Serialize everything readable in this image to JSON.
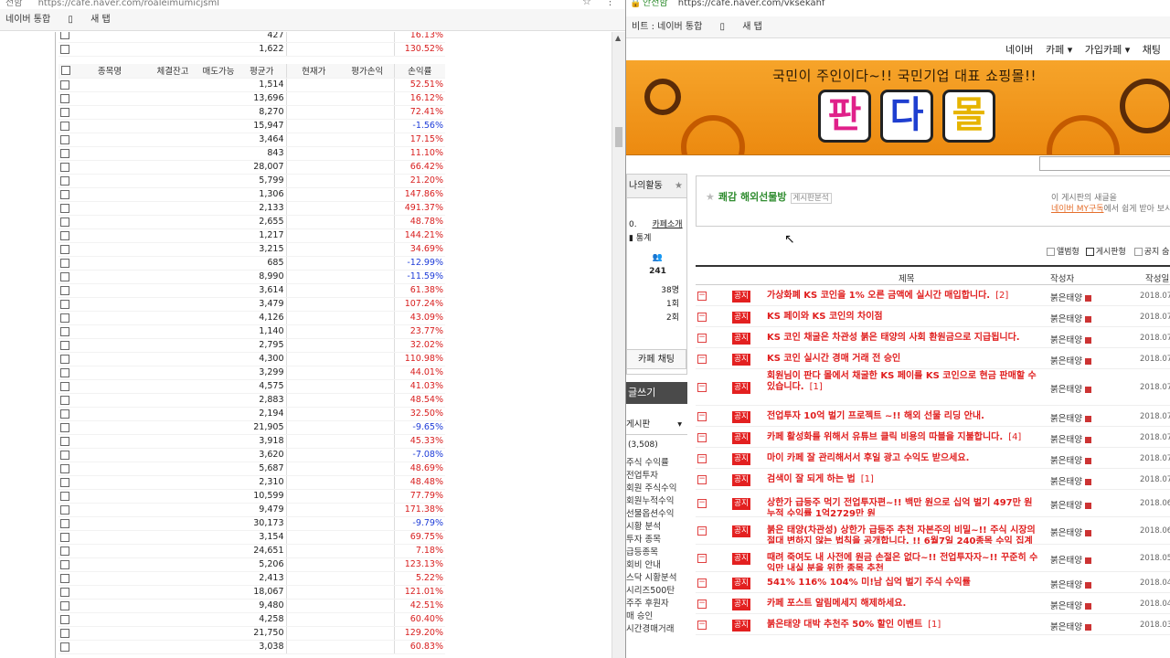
{
  "left_window": {
    "address": "https://cafe.naver.com/roaleimumicjsml",
    "lock_text": "전함",
    "bookmarks": [
      "네이버 통합",
      "새 탭"
    ],
    "top_rows": [
      {
        "avg": "427",
        "ret": "16.13%",
        "sign": "pos"
      },
      {
        "avg": "1,622",
        "ret": "130.52%",
        "sign": "pos"
      }
    ],
    "headers": {
      "name": "종목명",
      "balance": "체결잔고",
      "sellable": "매도가능",
      "avg": "평균가",
      "current": "현재가",
      "eval": "평가손익",
      "ret": "손익률"
    },
    "rows": [
      {
        "avg": "1,514",
        "ret": "52.51%",
        "sign": "pos"
      },
      {
        "avg": "13,696",
        "ret": "16.12%",
        "sign": "pos"
      },
      {
        "avg": "8,270",
        "ret": "72.41%",
        "sign": "pos"
      },
      {
        "avg": "15,947",
        "ret": "-1.56%",
        "sign": "neg"
      },
      {
        "avg": "3,464",
        "ret": "17.15%",
        "sign": "pos"
      },
      {
        "avg": "843",
        "ret": "11.10%",
        "sign": "pos"
      },
      {
        "avg": "28,007",
        "ret": "66.42%",
        "sign": "pos"
      },
      {
        "avg": "5,799",
        "ret": "21.20%",
        "sign": "pos"
      },
      {
        "avg": "1,306",
        "ret": "147.86%",
        "sign": "pos"
      },
      {
        "avg": "2,133",
        "ret": "491.37%",
        "sign": "pos"
      },
      {
        "avg": "2,655",
        "ret": "48.78%",
        "sign": "pos"
      },
      {
        "avg": "1,217",
        "ret": "144.21%",
        "sign": "pos"
      },
      {
        "avg": "3,215",
        "ret": "34.69%",
        "sign": "pos"
      },
      {
        "avg": "685",
        "ret": "-12.99%",
        "sign": "neg"
      },
      {
        "avg": "8,990",
        "ret": "-11.59%",
        "sign": "neg"
      },
      {
        "avg": "3,614",
        "ret": "61.38%",
        "sign": "pos"
      },
      {
        "avg": "3,479",
        "ret": "107.24%",
        "sign": "pos"
      },
      {
        "avg": "4,126",
        "ret": "43.09%",
        "sign": "pos"
      },
      {
        "avg": "1,140",
        "ret": "23.77%",
        "sign": "pos"
      },
      {
        "avg": "2,795",
        "ret": "32.02%",
        "sign": "pos"
      },
      {
        "avg": "4,300",
        "ret": "110.98%",
        "sign": "pos"
      },
      {
        "avg": "3,299",
        "ret": "44.01%",
        "sign": "pos"
      },
      {
        "avg": "4,575",
        "ret": "41.03%",
        "sign": "pos"
      },
      {
        "avg": "2,883",
        "ret": "48.54%",
        "sign": "pos"
      },
      {
        "avg": "2,194",
        "ret": "32.50%",
        "sign": "pos"
      },
      {
        "avg": "21,905",
        "ret": "-9.65%",
        "sign": "neg"
      },
      {
        "avg": "3,918",
        "ret": "45.33%",
        "sign": "pos"
      },
      {
        "avg": "3,620",
        "ret": "-7.08%",
        "sign": "neg"
      },
      {
        "avg": "5,687",
        "ret": "48.69%",
        "sign": "pos"
      },
      {
        "avg": "2,310",
        "ret": "48.48%",
        "sign": "pos"
      },
      {
        "avg": "10,599",
        "ret": "77.79%",
        "sign": "pos"
      },
      {
        "avg": "9,479",
        "ret": "171.38%",
        "sign": "pos"
      },
      {
        "avg": "30,173",
        "ret": "-9.79%",
        "sign": "neg"
      },
      {
        "avg": "3,154",
        "ret": "69.75%",
        "sign": "pos"
      },
      {
        "avg": "24,651",
        "ret": "7.18%",
        "sign": "pos"
      },
      {
        "avg": "5,206",
        "ret": "123.13%",
        "sign": "pos"
      },
      {
        "avg": "2,413",
        "ret": "5.22%",
        "sign": "pos"
      },
      {
        "avg": "18,067",
        "ret": "121.01%",
        "sign": "pos"
      },
      {
        "avg": "9,480",
        "ret": "42.51%",
        "sign": "pos"
      },
      {
        "avg": "4,258",
        "ret": "60.40%",
        "sign": "pos"
      },
      {
        "avg": "21,750",
        "ret": "129.20%",
        "sign": "pos"
      },
      {
        "avg": "3,038",
        "ret": "60.83%",
        "sign": "pos"
      }
    ]
  },
  "right_window": {
    "secure_label": "안전함",
    "address": "https://cafe.naver.com/vksekahf",
    "bookmarks": [
      "비트 : 네이버 통합",
      "새 탭"
    ],
    "topnav": [
      "네이버",
      "카페",
      "가입카페",
      "채팅"
    ],
    "banner_slogan": "국민이 주인이다~!! 국민기업 대표 쇼핑몰!!",
    "banner_logo": [
      "판",
      "다",
      "몰"
    ],
    "sidebar": {
      "tab": "나의활동",
      "lines": [
        "0.",
        "카페소개",
        "통계",
        "241",
        "38명",
        "1회",
        "2회"
      ],
      "chat": "카페 채팅",
      "write": "글쓰기",
      "board_select": "게시판",
      "count": "(3,508)",
      "menu": [
        "주식 수익률",
        "전업투자",
        "회원 주식수익",
        "회원누적수익",
        "선물옵션수익",
        "시황 분석",
        "투자 종목",
        "급등종목",
        "회비 안내",
        "스닥 시황분석",
        "시리즈500탄",
        "주주 후원자",
        "매 승인",
        "시간경매거래"
      ]
    },
    "board": {
      "title": "쾌감 해외선물방",
      "tag": "게시판분석",
      "info1": "이 게시판의 새글을",
      "info2_link": "네이버 MY구독",
      "info2_rest": "에서 쉽게 받아 보시려"
    },
    "view_opts": [
      "앨범형",
      "게시판형",
      "공지 숨"
    ],
    "col_title": "제목",
    "col_author": "작성자",
    "col_date": "작성일",
    "notice_label": "공지",
    "posts": [
      {
        "title": "가상화폐 KS 코인을 1% 오른 금액에 실시간 매입합니다.",
        "cnt": "[2]",
        "author": "붉은태양",
        "date": "2018.07"
      },
      {
        "title": "KS 페이와 KS 코인의 차이점",
        "cnt": "",
        "author": "붉은태양",
        "date": "2018.07"
      },
      {
        "title": "KS 코인 채굴은 차관성 붉은 태양의 사회 환원금으로 지급됩니다.",
        "cnt": "",
        "author": "붉은태양",
        "date": "2018.07"
      },
      {
        "title": "KS 코인 실시간 경매 거래 전 승인",
        "cnt": "",
        "author": "붉은태양",
        "date": "2018.07"
      },
      {
        "title": "회원님이 판다 몰에서 채굴한 KS 페이를 KS 코인으로 현금 판매할 수 있습니다.",
        "cnt": "[1]",
        "author": "붉은태양",
        "date": "2018.07"
      },
      {
        "title": "전업투자 10억 벌기 프로젝트 ~!! 해외 선물 리딩 안내.",
        "cnt": "",
        "author": "붉은태양",
        "date": "2018.07"
      },
      {
        "title": "카페 활성화를 위해서 유튜브 클릭 비용의 따블을 지불합니다.",
        "cnt": "[4]",
        "author": "붉은태양",
        "date": "2018.07"
      },
      {
        "title": "마이 카페 잘 관리해서서 후일 광고 수익도 받으세요.",
        "cnt": "",
        "author": "붉은태양",
        "date": "2018.07"
      },
      {
        "title": "검색이 잘 되게 하는 법",
        "cnt": "[1]",
        "author": "붉은태양",
        "date": "2018.07"
      },
      {
        "title": "상한가 급등주 먹기 전업투자편~!! 백만 원으로 십억 벌기 497만 원 누적 수익률 1억2729만 원",
        "cnt": "",
        "author": "붉은태양",
        "date": "2018.06"
      },
      {
        "title": "붉은 태양(차관성) 상한가 급등주 추천 자본주의 비밀~!! 주식 시장의 절대 변하지 않는 법칙을 공개합니다. !! 6월7일 240종목 수익 집계",
        "cnt": "",
        "author": "붉은태양",
        "date": "2018.06"
      },
      {
        "title": "때려 죽여도 내 사전에 원금 손절은 없다~!! 전업투자자~!! 꾸준히 수익만 내실 분을 위한 종목 추천",
        "cnt": "",
        "author": "붉은태양",
        "date": "2018.05"
      },
      {
        "title": "541% 116% 104% 미!남 십억 벌기 주식 수익률",
        "cnt": "",
        "author": "붉은태양",
        "date": "2018.04"
      },
      {
        "title": "카페 포스트 알림메세지 해제하세요.",
        "cnt": "",
        "author": "붉은태양",
        "date": "2018.04"
      },
      {
        "title": "붉은태양 대박 추천주 50% 할인 이벤트",
        "cnt": "[1]",
        "author": "붉은태양",
        "date": "2018.03"
      }
    ],
    "colors": {
      "notice_red": "#e32020",
      "banner_orange": "#ec8a10",
      "title_green": "#2f8c2f"
    }
  }
}
